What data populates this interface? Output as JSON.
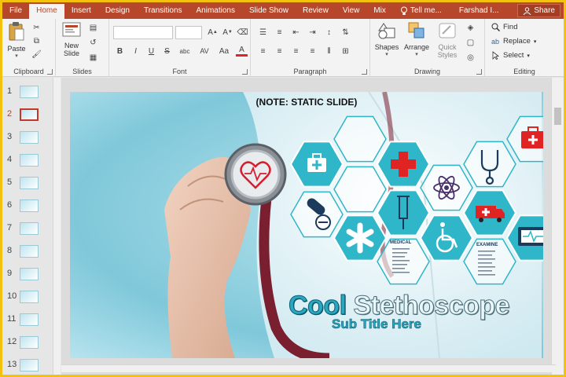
{
  "tabs": [
    {
      "label": "File",
      "name": "tab-file"
    },
    {
      "label": "Home",
      "name": "tab-home",
      "active": true
    },
    {
      "label": "Insert",
      "name": "tab-insert"
    },
    {
      "label": "Design",
      "name": "tab-design"
    },
    {
      "label": "Transitions",
      "name": "tab-transitions"
    },
    {
      "label": "Animations",
      "name": "tab-animations"
    },
    {
      "label": "Slide Show",
      "name": "tab-slide-show"
    },
    {
      "label": "Review",
      "name": "tab-review"
    },
    {
      "label": "View",
      "name": "tab-view"
    },
    {
      "label": "Mix",
      "name": "tab-mix"
    }
  ],
  "tell_me": "Tell me...",
  "user": "Farshad I...",
  "share": "Share",
  "ribbon": {
    "clipboard": {
      "label": "Clipboard",
      "paste": "Paste"
    },
    "slides": {
      "label": "Slides",
      "new_slide_line1": "New",
      "new_slide_line2": "Slide"
    },
    "font": {
      "label": "Font",
      "bold": "B",
      "italic": "I",
      "underline": "U",
      "strike": "S",
      "shadow": "abc",
      "spacing": "AV",
      "case": "Aa",
      "font_color": "A"
    },
    "paragraph": {
      "label": "Paragraph"
    },
    "drawing": {
      "label": "Drawing",
      "shapes": "Shapes",
      "arrange": "Arrange",
      "quick_styles_line1": "Quick",
      "quick_styles_line2": "Styles"
    },
    "editing": {
      "label": "Editing",
      "find": "Find",
      "replace": "Replace",
      "select": "Select"
    }
  },
  "thumbnails": [
    "1",
    "2",
    "3",
    "4",
    "5",
    "6",
    "7",
    "8",
    "9",
    "10",
    "11",
    "12",
    "13"
  ],
  "active_slide": "2",
  "slide": {
    "note": "(NOTE: STATIC SLIDE)",
    "title_part1": "Cool",
    "title_part2": "Stethoscope",
    "subtitle": "Sub Title Here",
    "medical_label": "MEDICAL",
    "examine_label": "EXAMINE",
    "colors": {
      "teal": "#2fb6c8",
      "red": "#e02424",
      "navy": "#1b3a5c"
    }
  }
}
